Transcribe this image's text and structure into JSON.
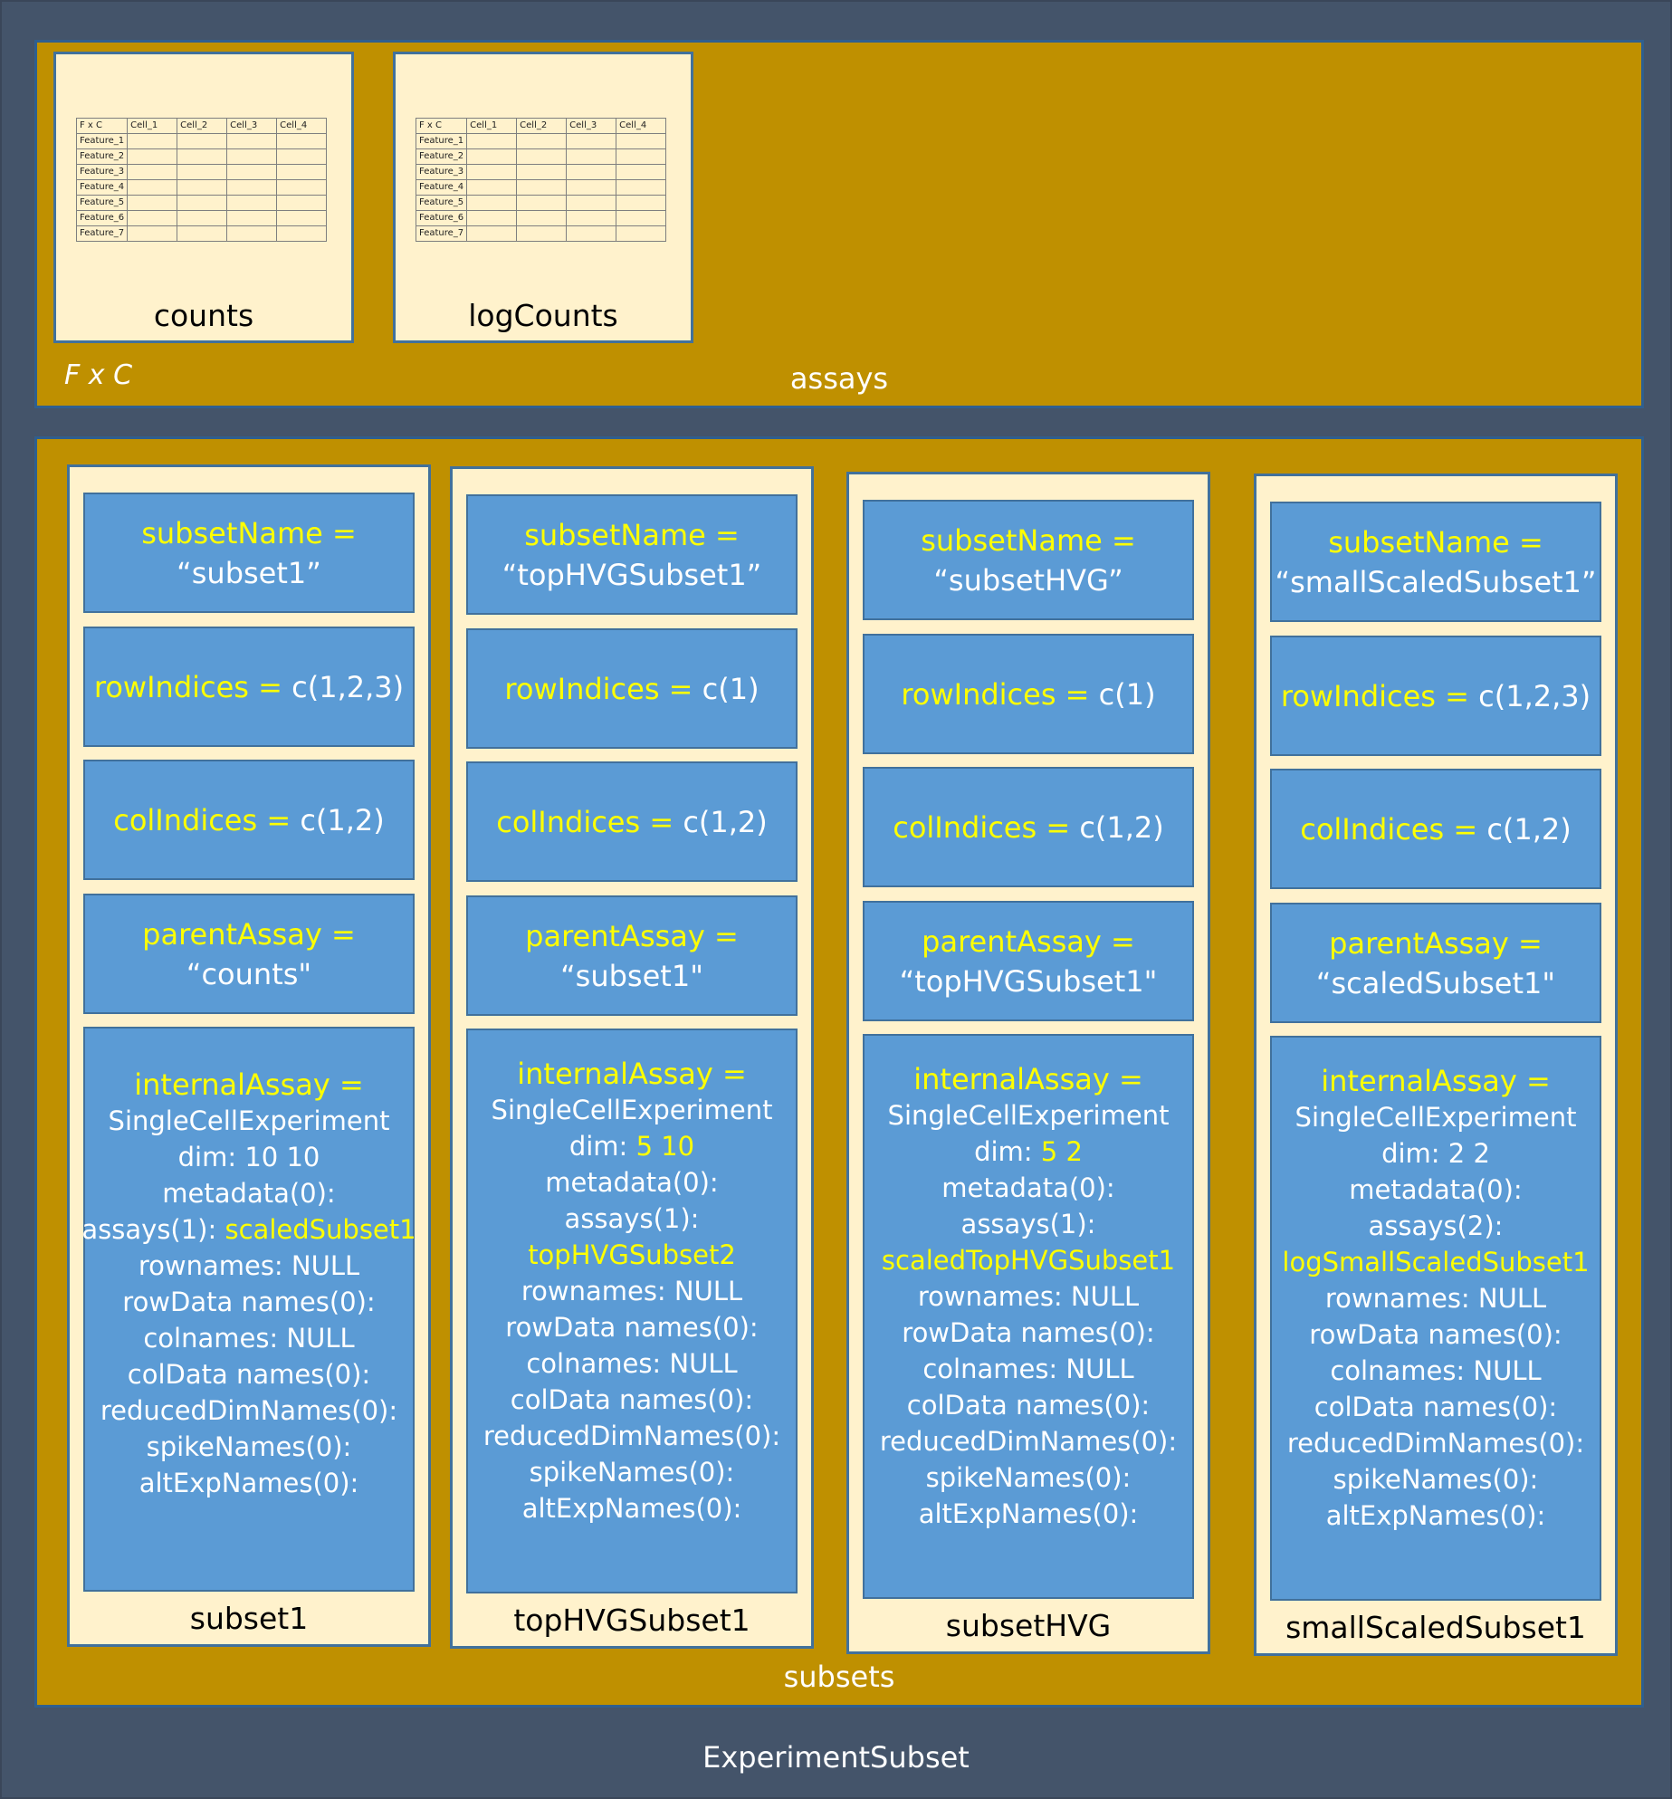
{
  "experiment_label": "ExperimentSubset",
  "assays": {
    "section_label": "assays",
    "dims_label": "F x C",
    "matrices": [
      {
        "name": "counts",
        "header": [
          "F x C",
          "Cell_1",
          "Cell_2",
          "Cell_3",
          "Cell_4"
        ],
        "rows": [
          "Feature_1",
          "Feature_2",
          "Feature_3",
          "Feature_4",
          "Feature_5",
          "Feature_6",
          "Feature_7"
        ]
      },
      {
        "name": "logCounts",
        "header": [
          "F x C",
          "Cell_1",
          "Cell_2",
          "Cell_3",
          "Cell_4"
        ],
        "rows": [
          "Feature_1",
          "Feature_2",
          "Feature_3",
          "Feature_4",
          "Feature_5",
          "Feature_6",
          "Feature_7"
        ]
      }
    ]
  },
  "subsets": {
    "section_label": "subsets",
    "items": [
      {
        "label": "subset1",
        "subsetName_key": "subsetName =",
        "subsetName_val": "“subset1”",
        "rowIndices_key": "rowIndices =",
        "rowIndices_val": "c(1,2,3)",
        "colIndices_key": "colIndices =",
        "colIndices_val": "c(1,2)",
        "parentAssay_key": "parentAssay =",
        "parentAssay_val": "“counts\"",
        "internal_key": "internalAssay =",
        "internal_class": "SingleCellExperiment",
        "dim_key": "dim:",
        "dim_val": "10 10",
        "metadata": "metadata(0):",
        "assays_key": "assays(1):",
        "assays_val": "scaledSubset1",
        "rownames": "rownames: NULL",
        "rowData": "rowData names(0):",
        "colnames": "colnames: NULL",
        "colData": "colData names(0):",
        "reducedDim": "reducedDimNames(0):",
        "spike": "spikeNames(0):",
        "altExp": "altExpNames(0):"
      },
      {
        "label": "topHVGSubset1",
        "subsetName_key": "subsetName =",
        "subsetName_val": "“topHVGSubset1”",
        "rowIndices_key": "rowIndices =",
        "rowIndices_val": "c(1)",
        "colIndices_key": "colIndices =",
        "colIndices_val": "c(1,2)",
        "parentAssay_key": "parentAssay =",
        "parentAssay_val": "“subset1\"",
        "internal_key": "internalAssay =",
        "internal_class": "SingleCellExperiment",
        "dim_key": "dim:",
        "dim_val": "5 10",
        "metadata": "metadata(0):",
        "assays_key": "assays(1):",
        "assays_val": "topHVGSubset2",
        "rownames": "rownames: NULL",
        "rowData": "rowData names(0):",
        "colnames": "colnames: NULL",
        "colData": "colData names(0):",
        "reducedDim": "reducedDimNames(0):",
        "spike": "spikeNames(0):",
        "altExp": "altExpNames(0):"
      },
      {
        "label": "subsetHVG",
        "subsetName_key": "subsetName =",
        "subsetName_val": "“subsetHVG”",
        "rowIndices_key": "rowIndices =",
        "rowIndices_val": "c(1)",
        "colIndices_key": "colIndices =",
        "colIndices_val": "c(1,2)",
        "parentAssay_key": "parentAssay =",
        "parentAssay_val": "“topHVGSubset1\"",
        "internal_key": "internalAssay =",
        "internal_class": "SingleCellExperiment",
        "dim_key": "dim:",
        "dim_val": "5 2",
        "metadata": "metadata(0):",
        "assays_key": "assays(1):",
        "assays_val": "scaledTopHVGSubset1",
        "rownames": "rownames: NULL",
        "rowData": "rowData names(0):",
        "colnames": "colnames: NULL",
        "colData": "colData names(0):",
        "reducedDim": "reducedDimNames(0):",
        "spike": "spikeNames(0):",
        "altExp": "altExpNames(0):"
      },
      {
        "label": "smallScaledSubset1",
        "subsetName_key": "subsetName =",
        "subsetName_val": "“smallScaledSubset1”",
        "rowIndices_key": "rowIndices =",
        "rowIndices_val": "c(1,2,3)",
        "colIndices_key": "colIndices =",
        "colIndices_val": "c(1,2)",
        "parentAssay_key": "parentAssay =",
        "parentAssay_val": "“scaledSubset1\"",
        "internal_key": "internalAssay =",
        "internal_class": "SingleCellExperiment",
        "dim_key": "dim:",
        "dim_val": "2 2",
        "metadata": "metadata(0):",
        "assays_key": "assays(2):",
        "assays_val": "logSmallScaledSubset1",
        "rownames": "rownames: NULL",
        "rowData": "rowData names(0):",
        "colnames": "colnames: NULL",
        "colData": "colData names(0):",
        "reducedDim": "reducedDimNames(0):",
        "spike": "spikeNames(0):",
        "altExp": "altExpNames(0):"
      }
    ]
  },
  "colors": {
    "background": "#44546a",
    "panel": "#bf9000",
    "card": "#fff2cc",
    "field": "#5b9bd5",
    "highlight": "#ffff00"
  }
}
